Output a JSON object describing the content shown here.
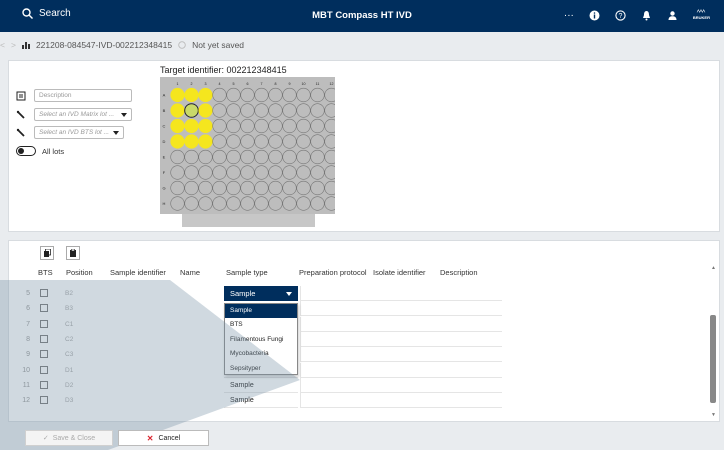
{
  "header": {
    "search_label": "Search",
    "app_title": "MBT Compass HT IVD",
    "logo_text": "BRUKER",
    "more_label": "···"
  },
  "breadcrumb": {
    "run_id": "221208-084547-IVD-002212348415",
    "save_status": "Not yet saved"
  },
  "form": {
    "description_placeholder": "Description",
    "matrix_lot_placeholder": "Select an IVD Matrix lot ...",
    "bts_lot_placeholder": "Select an IVD BTS lot ...",
    "all_lots_label": "All lots"
  },
  "target": {
    "title": "Target identifier: 002212348415",
    "column_labels": [
      "1",
      "2",
      "3",
      "4",
      "5",
      "6",
      "7",
      "8",
      "9",
      "10",
      "11",
      "12"
    ],
    "row_labels": [
      "A",
      "B",
      "C",
      "D",
      "E",
      "F",
      "G",
      "H"
    ],
    "filled_wells": [
      "A1",
      "A2",
      "A3",
      "B1",
      "B3",
      "C1",
      "C2",
      "C3",
      "D1",
      "D2",
      "D3"
    ],
    "selected_well": "B2",
    "filled_color": "#f5e61e",
    "selected_color": "#c9d96a"
  },
  "table": {
    "columns": [
      "BTS",
      "Position",
      "Sample identifier",
      "Name",
      "Sample type",
      "Preparation protocol",
      "Isolate identifier",
      "Description"
    ],
    "rows": [
      {
        "num": "5",
        "position": "B2",
        "sample_type": "Sample"
      },
      {
        "num": "6",
        "position": "B3",
        "sample_type": ""
      },
      {
        "num": "7",
        "position": "C1",
        "sample_type": ""
      },
      {
        "num": "8",
        "position": "C2",
        "sample_type": ""
      },
      {
        "num": "9",
        "position": "C3",
        "sample_type": ""
      },
      {
        "num": "10",
        "position": "D1",
        "sample_type": "Sample"
      },
      {
        "num": "11",
        "position": "D2",
        "sample_type": "Sample"
      },
      {
        "num": "12",
        "position": "D3",
        "sample_type": "Sample"
      }
    ],
    "dropdown_options": [
      "Sample",
      "BTS",
      "Filamentous Fungi",
      "Mycobacteria",
      "Sepsityper"
    ],
    "selected_value": "Sample"
  },
  "footer": {
    "save_label": "Save & Close",
    "cancel_label": "Cancel"
  },
  "colors": {
    "header_bg": "#002e5d",
    "cancel_icon": "#d9232e",
    "highlight": "#002e5d"
  }
}
